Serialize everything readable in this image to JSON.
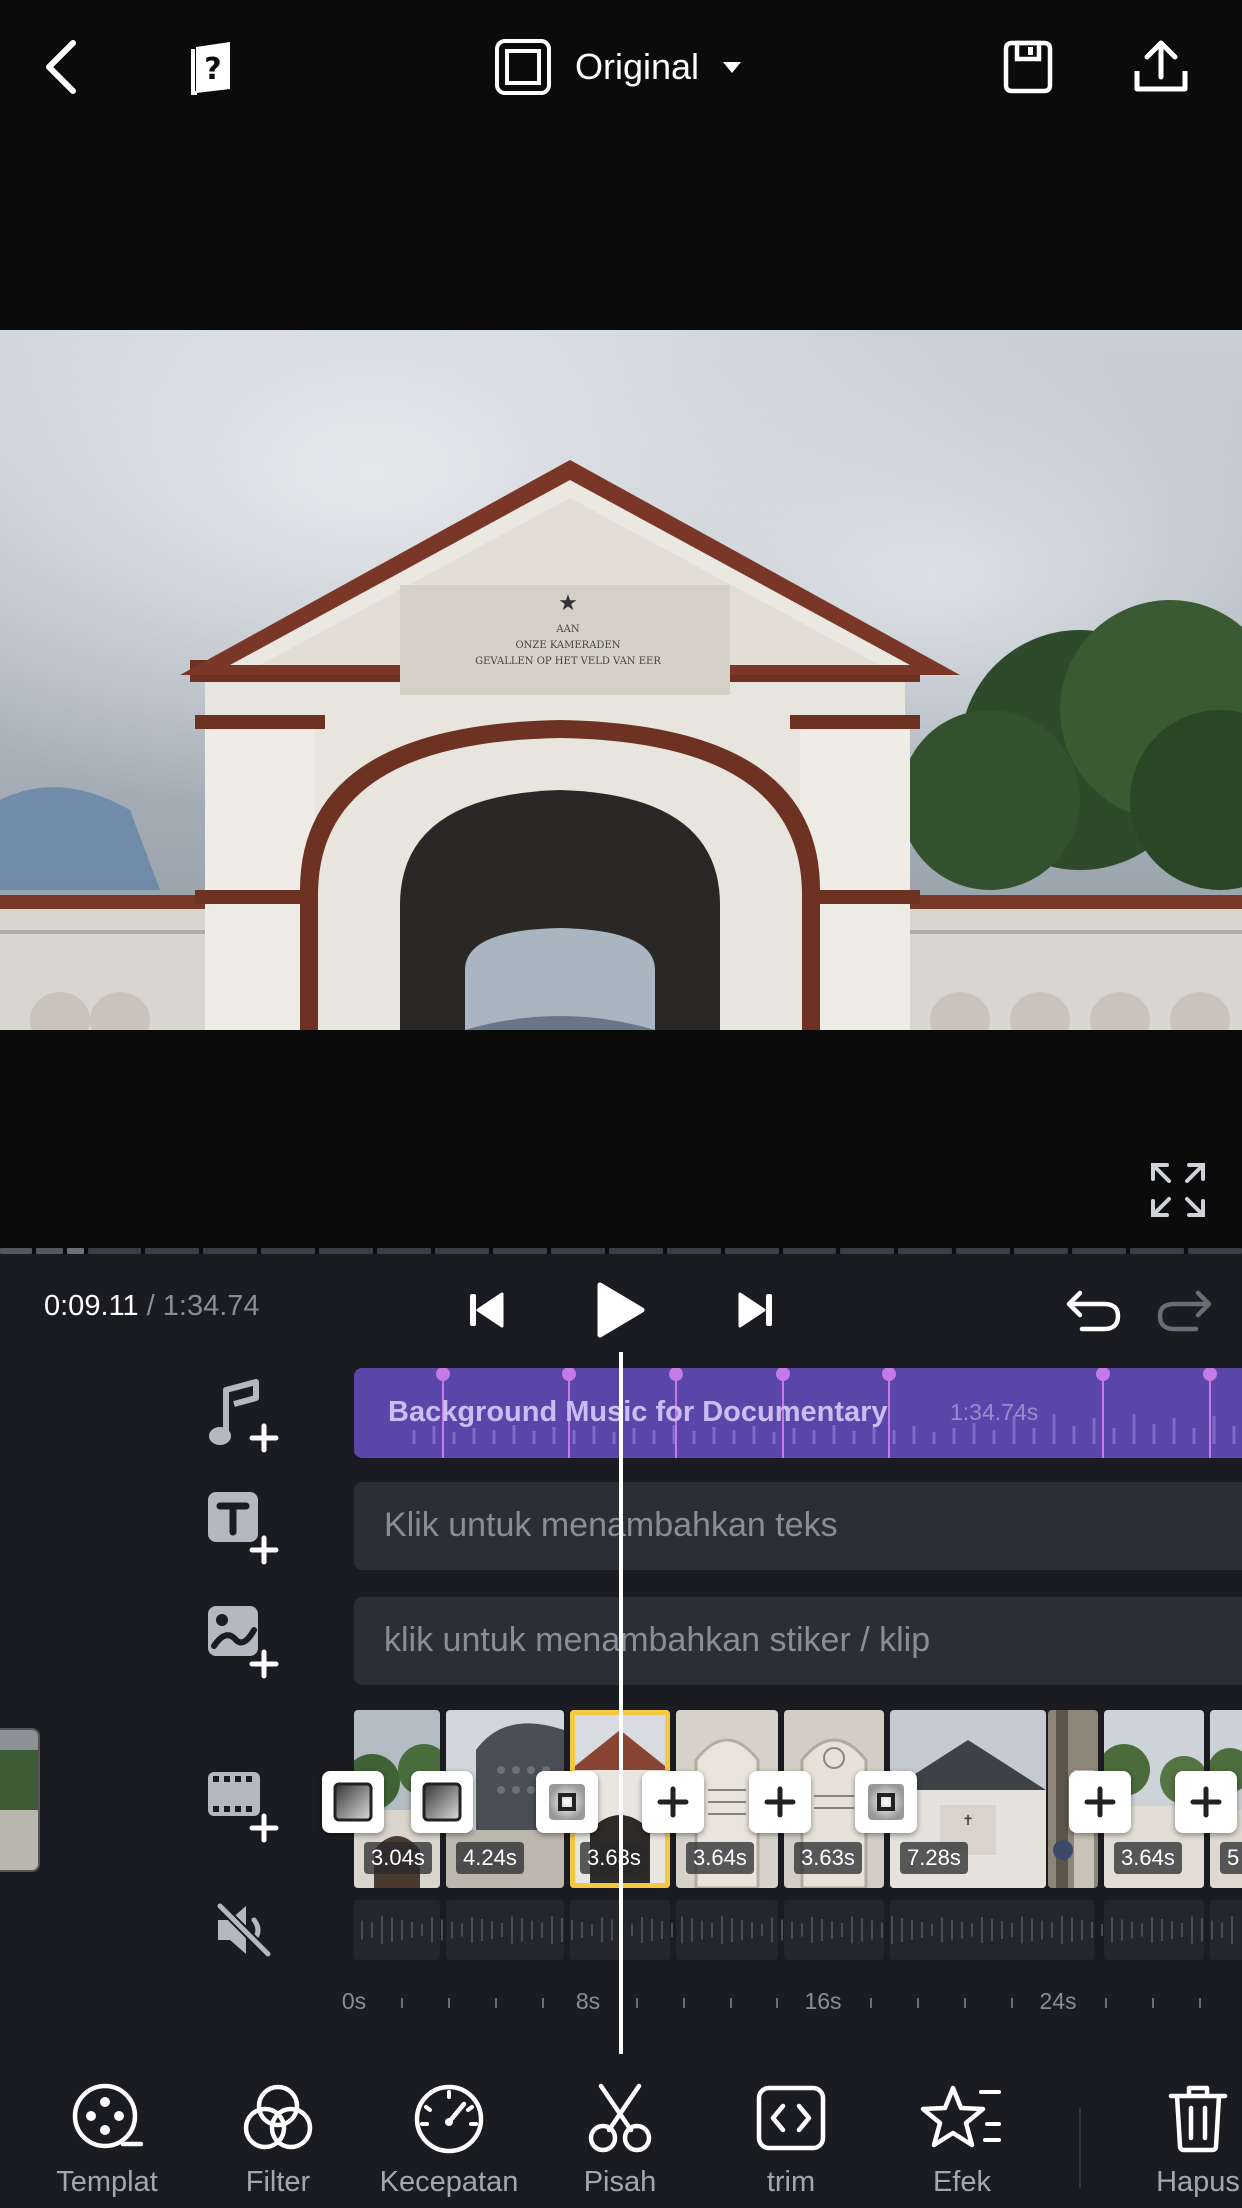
{
  "header": {
    "aspect_label": "Original",
    "icons": {
      "back": "chevron-left-icon",
      "help": "help-book-icon",
      "aspect": "aspect-ratio-icon",
      "dropdown": "caret-down-icon",
      "save": "save-icon",
      "export": "export-upload-icon"
    }
  },
  "player": {
    "current_time": "0:09.11",
    "separator": " / ",
    "total_time": "1:34.74",
    "icons": {
      "prev": "skip-previous-icon",
      "play": "play-icon",
      "next": "skip-next-icon",
      "undo": "undo-icon",
      "redo": "redo-icon",
      "fullscreen": "fullscreen-icon"
    }
  },
  "tracks": {
    "music": {
      "title": "Background Music for Documentary",
      "duration": "1:34.74s",
      "icon": "music-add-icon"
    },
    "text": {
      "placeholder": "Klik untuk menambahkan teks",
      "icon": "text-add-icon"
    },
    "sticker": {
      "placeholder": "klik untuk menambahkan stiker / klip",
      "icon": "sticker-add-icon"
    },
    "video": {
      "icon": "video-add-icon"
    },
    "audio": {
      "icon": "mute-icon"
    }
  },
  "clips": [
    {
      "duration": "3.04s",
      "selected": false
    },
    {
      "duration": "4.24s",
      "selected": false
    },
    {
      "duration": "3.63s",
      "selected": true
    },
    {
      "duration": "3.64s",
      "selected": false
    },
    {
      "duration": "3.63s",
      "selected": false
    },
    {
      "duration": "7.28s",
      "selected": false
    },
    {
      "duration": "",
      "selected": false
    },
    {
      "duration": "3.64s",
      "selected": false
    },
    {
      "duration": "5",
      "selected": false
    }
  ],
  "ruler": {
    "labels": [
      "0s",
      "8s",
      "16s",
      "24s"
    ]
  },
  "toolbar": {
    "items": [
      {
        "label": "Templat",
        "icon": "template-reel-icon"
      },
      {
        "label": "Filter",
        "icon": "filter-circles-icon"
      },
      {
        "label": "Kecepatan",
        "icon": "speed-gauge-icon"
      },
      {
        "label": "Pisah",
        "icon": "scissors-icon"
      },
      {
        "label": "trim",
        "icon": "trim-code-icon"
      },
      {
        "label": "Efek",
        "icon": "effects-star-icon"
      },
      {
        "label": "Hapus",
        "icon": "trash-icon"
      }
    ]
  },
  "colors": {
    "accent_purple": "#5a45a8",
    "selected_clip": "#f5c842",
    "editor_bg": "#1b1c21"
  }
}
